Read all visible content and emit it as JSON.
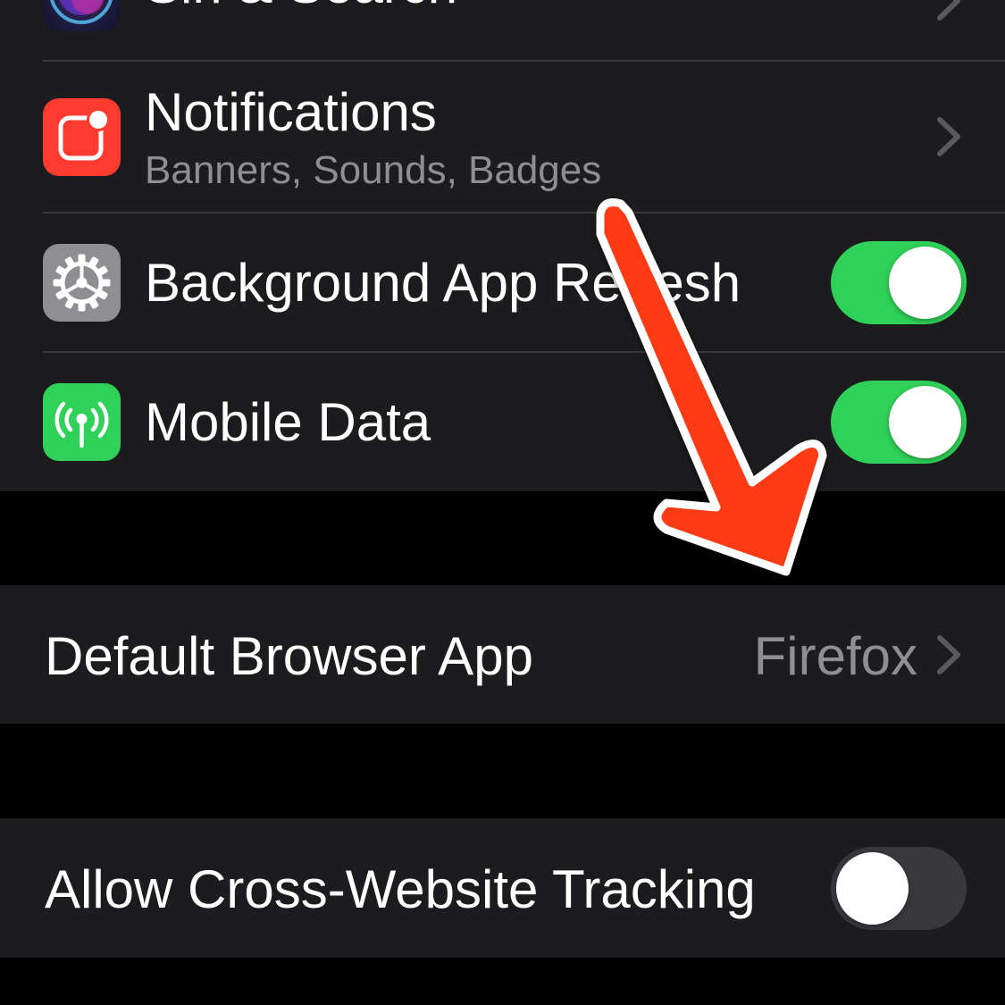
{
  "siri_row": {
    "label": "Siri & Search",
    "icon": "siri-icon"
  },
  "notifications_row": {
    "label": "Notifications",
    "subtitle": "Banners, Sounds, Badges",
    "icon": "notifications-icon",
    "icon_color": "#ff3b30"
  },
  "background_refresh_row": {
    "label": "Background App Refresh",
    "icon": "gear-icon",
    "icon_color": "#8e8e93",
    "toggle_on": true
  },
  "mobile_data_row": {
    "label": "Mobile Data",
    "icon": "antenna-icon",
    "icon_color": "#30d158",
    "toggle_on": true
  },
  "default_browser_row": {
    "label": "Default Browser App",
    "value": "Firefox"
  },
  "tracking_row": {
    "label": "Allow Cross-Website Tracking",
    "toggle_on": false
  },
  "annotation": {
    "icon": "red-arrow-icon",
    "color": "#ff3b15"
  },
  "colors": {
    "toggle_on": "#30d158",
    "toggle_off": "#39393d",
    "cell_background": "#1c1c1e",
    "page_background": "#000000"
  }
}
